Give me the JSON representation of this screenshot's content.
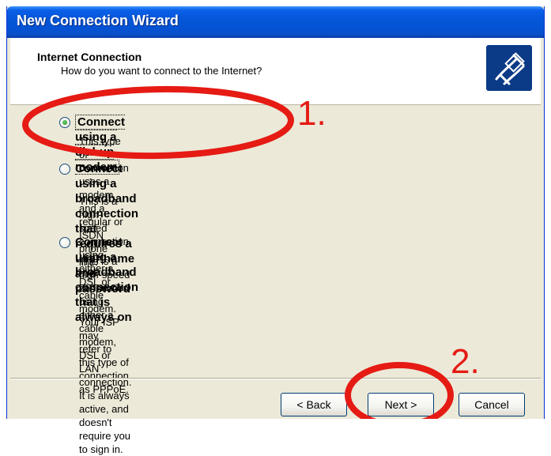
{
  "window": {
    "title": "New Connection Wizard"
  },
  "header": {
    "title": "Internet Connection",
    "subtitle": "How do you want to connect to the Internet?"
  },
  "options": [
    {
      "label": "Connect using a dial-up modem",
      "description": "This type of connection uses a modem and a regular or ISDN phone line.",
      "selected": true
    },
    {
      "label_line1": "Connect using a broadband connection that requires a user name and",
      "label_line2": "password",
      "description_line1": "This is a high-speed connection using either a DSL or cable modem. Your ISP may",
      "description_line2": "refer to this type of connection as PPPoE.",
      "selected": false
    },
    {
      "label": "Connect using a broadband connection that is always on",
      "description_line1": "This is a high-speed connection using either a cable modem, DSL or LAN",
      "description_line2": "connection. It is always active, and doesn't require you to sign in.",
      "selected": false
    }
  ],
  "buttons": {
    "back": "< Back",
    "next": "Next >",
    "cancel": "Cancel"
  },
  "annotations": {
    "step1": "1.",
    "step2": "2.",
    "color": "#e51b14"
  }
}
